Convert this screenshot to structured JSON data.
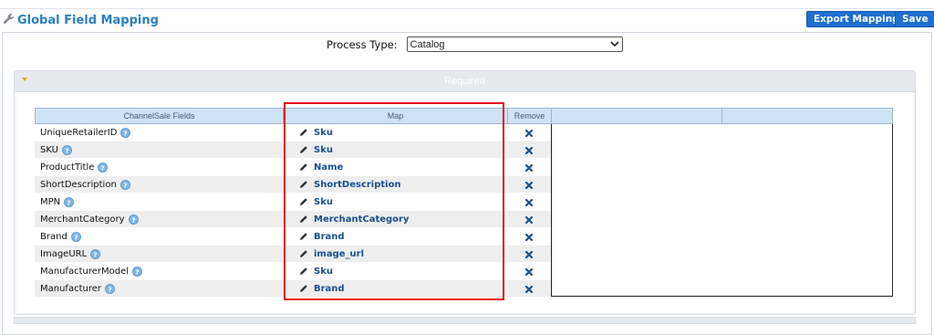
{
  "header": {
    "title": "Global Field Mapping",
    "title_icon": "wrench-icon",
    "export_label": "Export Mapping",
    "save_label": "Save"
  },
  "process": {
    "label": "Process Type:",
    "selected": "Catalog"
  },
  "section": {
    "title": "Required"
  },
  "grid": {
    "columns": [
      "ChannelSale Fields",
      "Map",
      "Remove",
      "",
      ""
    ],
    "rows": [
      {
        "field": "UniqueRetailerID",
        "map": "Sku"
      },
      {
        "field": "SKU",
        "map": "Sku"
      },
      {
        "field": "ProductTitle",
        "map": "Name"
      },
      {
        "field": "ShortDescription",
        "map": "ShortDescription"
      },
      {
        "field": "MPN",
        "map": "Sku"
      },
      {
        "field": "MerchantCategory",
        "map": "MerchantCategory"
      },
      {
        "field": "Brand",
        "map": "Brand"
      },
      {
        "field": "ImageURL",
        "map": "image_url"
      },
      {
        "field": "ManufacturerModel",
        "map": "Sku"
      },
      {
        "field": "Manufacturer",
        "map": "Brand"
      }
    ]
  },
  "colors": {
    "accent": "#2a7fc1",
    "button": "#1f6fd1",
    "highlight": "#e3101c",
    "remove": "#1a4f8f"
  }
}
